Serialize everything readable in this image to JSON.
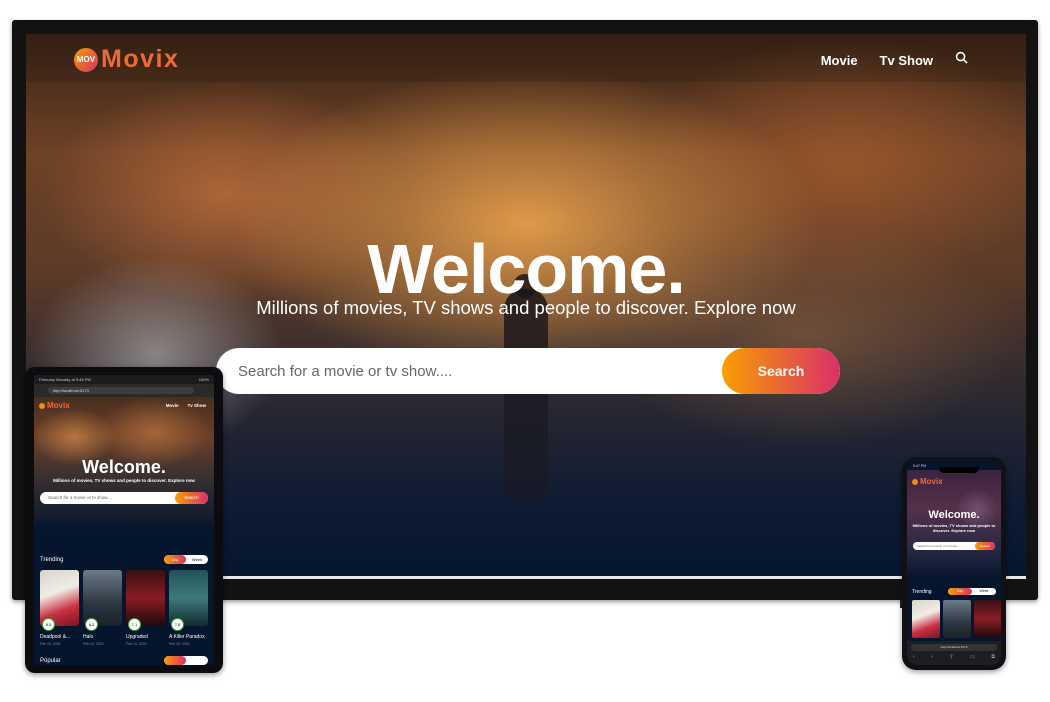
{
  "tv": {
    "logo_badge": "MOV",
    "logo_text": "Movix",
    "nav": {
      "movie": "Movie",
      "tv_show": "Tv Show"
    },
    "hero_title": "Welcome.",
    "hero_subtitle": "Millions of movies, TV shows and people to discover. Explore now",
    "search_placeholder": "Search for a movie or tv show....",
    "search_button": "Search"
  },
  "tablet": {
    "status_left": "February Monday at 9:46 PM",
    "status_right": "100%",
    "url": "http://localhost:5173",
    "logo_text": "Movix",
    "nav": {
      "movie": "Movie",
      "tv_show": "Tv Show"
    },
    "hero_title": "Welcome.",
    "hero_subtitle": "Millions of movies, TV shows and people to discover. Explore now",
    "search_placeholder": "Search for a movie or tv show....",
    "search_button": "Search",
    "trending_label": "Trending",
    "switch": {
      "day": "Day",
      "week": "Week"
    },
    "cards": [
      {
        "title": "Deadpool &...",
        "date": "Feb 10, 2024",
        "rating": "8.0"
      },
      {
        "title": "Halo",
        "date": "Feb 10, 2024",
        "rating": "8.3"
      },
      {
        "title": "Upgraded",
        "date": "Feb 10, 2024",
        "rating": "7.1"
      },
      {
        "title": "A Killer Paradox",
        "date": "Feb 10, 2024",
        "rating": "7.8"
      }
    ],
    "popular_label": "Popular"
  },
  "phone": {
    "status_time": "9:47 PM",
    "logo_text": "Movix",
    "hero_title": "Welcome.",
    "hero_subtitle": "Millions of movies, TV shows and people to discover. Explore now",
    "search_placeholder": "Search for a movie or tv show....",
    "search_button": "Search",
    "trending_label": "Trending",
    "switch": {
      "day": "Day",
      "week": "Week"
    },
    "url": "http://localhost:5173"
  },
  "colors": {
    "accent_start": "#f89e00",
    "accent_end": "#da2f68",
    "brand": "#ee6a35",
    "navy": "#04152d"
  },
  "icons": {
    "search": "search-icon",
    "back": "back-icon",
    "forward": "forward-icon",
    "share": "share-icon",
    "book": "bookmarks-icon",
    "tabs": "tabs-icon"
  }
}
